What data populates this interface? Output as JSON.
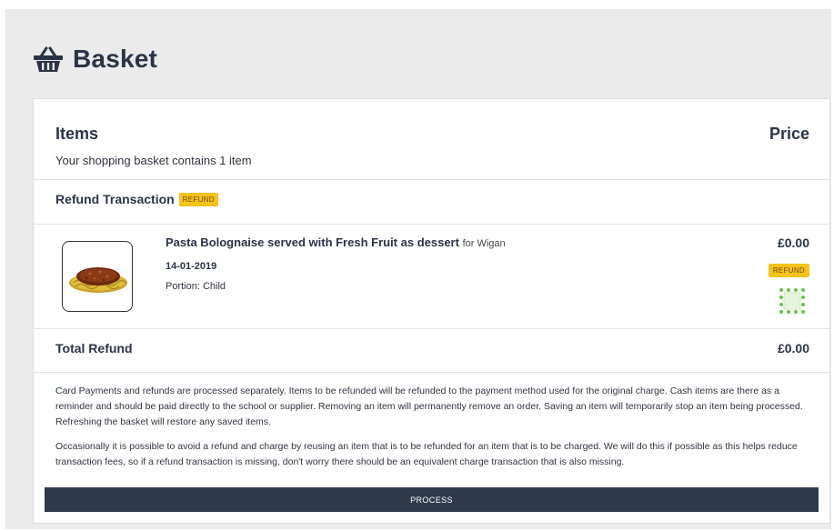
{
  "page": {
    "title": "Basket",
    "title_icon": "basket-icon"
  },
  "basket": {
    "items_header": "Items",
    "price_header": "Price",
    "summary": "Your shopping basket contains 1 item",
    "section_title": "Refund Transaction",
    "section_badge": "REFUND",
    "items": [
      {
        "name": "Pasta Bolognaise served with Fresh Fruit as dessert",
        "for_text": "for Wigan",
        "date": "14-01-2019",
        "portion": "Portion: Child",
        "price": "£0.00",
        "badge": "REFUND",
        "image": "pasta-bolognaise-image",
        "action_icon": "dotted-grid-icon"
      }
    ],
    "total_label": "Total Refund",
    "total_value": "£0.00",
    "notice_1": "Card Payments and refunds are processed separately. Items to be refunded will be refunded to the payment method used for the original charge. Cash items are there as a reminder and should be paid directly to the school or supplier. Removing an item will permanently remove an order. Saving an item will temporarily stop an item being processed. Refreshing the basket will restore any saved items.",
    "notice_2": "Occasionally it is possible to avoid a refund and charge by reusing an item that is to be refunded for an item that is to be charged. We will do this if possible as this helps reduce transaction fees, so if a refund transaction is missing, don't worry there should be an equivalent charge transaction that is also missing.",
    "process_label": "PROCESS"
  },
  "colors": {
    "navy": "#2b3346",
    "badge_yellow": "#f7c21b",
    "button_bg": "#2f3a4d",
    "dots_green": "#6cc24a",
    "page_bg": "#ebebeb"
  }
}
